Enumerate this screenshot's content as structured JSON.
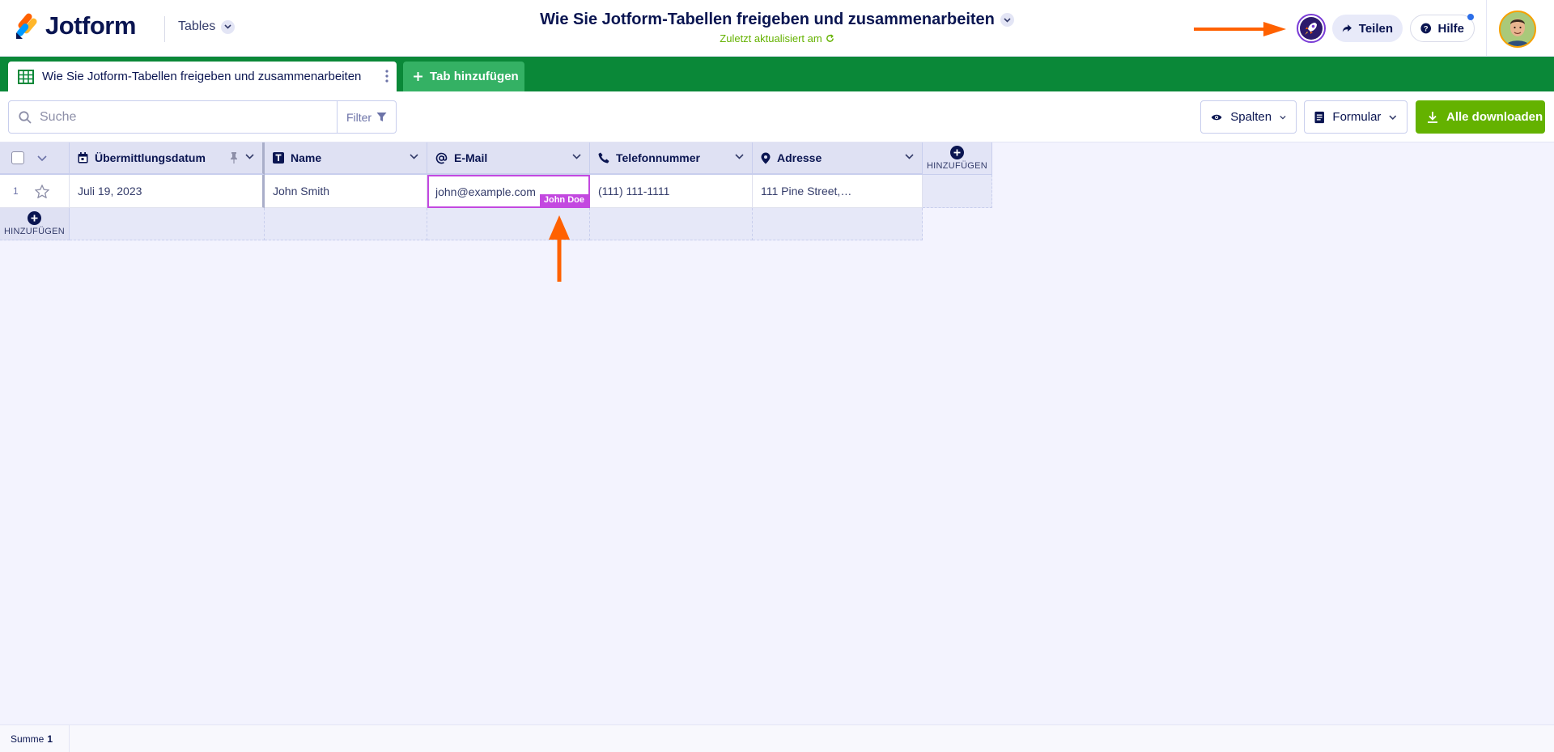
{
  "header": {
    "logo_text": "Jotform",
    "tables_label": "Tables",
    "doc_title": "Wie Sie Jotform-Tabellen freigeben und zusammenarbeiten",
    "last_updated": "Zuletzt aktualisiert am",
    "share_label": "Teilen",
    "help_label": "Hilfe"
  },
  "tabs": {
    "active_label": "Wie Sie Jotform-Tabellen freigeben und zusammenarbeiten",
    "add_label": "Tab hinzufügen"
  },
  "toolbar": {
    "search_placeholder": "Suche",
    "filter_label": "Filter",
    "columns_label": "Spalten",
    "form_label": "Formular",
    "download_label": "Alle downloaden"
  },
  "table": {
    "columns": [
      {
        "label": "Übermittlungsdatum",
        "icon": "calendar-icon"
      },
      {
        "label": "Name",
        "icon": "text-icon"
      },
      {
        "label": "E-Mail",
        "icon": "at-icon"
      },
      {
        "label": "Telefonnummer",
        "icon": "phone-icon"
      },
      {
        "label": "Adresse",
        "icon": "location-icon"
      }
    ],
    "add_column_label": "HINZUFÜGEN",
    "add_row_label": "HINZUFÜGEN",
    "rows": [
      {
        "number": "1",
        "cells": [
          "Juli 19, 2023",
          "John Smith",
          "john@example.com",
          "(111) 111-1111",
          "111 Pine Street,…"
        ]
      }
    ],
    "collaborator_badge": "John Doe"
  },
  "footer": {
    "sum_label": "Summe",
    "sum_value": "1"
  },
  "colors": {
    "brand_navy": "#0a1551",
    "tab_bar_green": "#0a8838",
    "add_tab_green": "#34b164",
    "download_green": "#64b200",
    "collaborator_purple": "#c348e0",
    "annotation_orange": "#ff6100"
  }
}
